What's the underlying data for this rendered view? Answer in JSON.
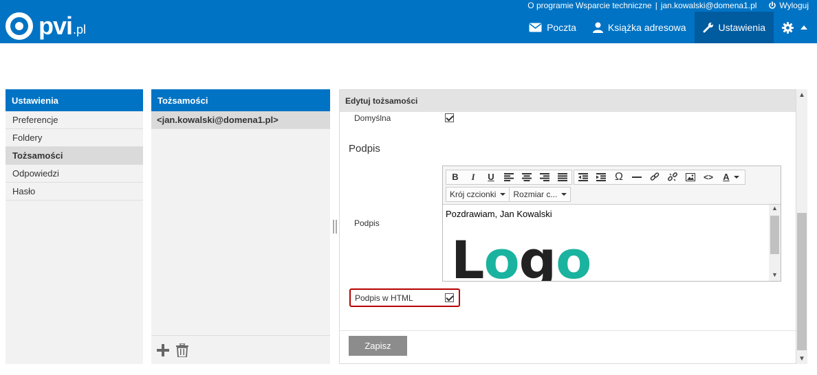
{
  "header": {
    "logo_text": "pvi",
    "logo_tld": ".pl",
    "toplinks": {
      "about": "O programie",
      "support": "Wsparcie techniczne",
      "separator": "|",
      "user": "jan.kowalski@domena1.pl",
      "logout": "Wyloguj"
    },
    "nav": {
      "mail": "Poczta",
      "contacts": "Książka adresowa",
      "settings": "Ustawienia"
    }
  },
  "settings_column": {
    "title": "Ustawienia",
    "items": [
      "Preferencje",
      "Foldery",
      "Tożsamości",
      "Odpowiedzi",
      "Hasło"
    ],
    "selected": "Tożsamości"
  },
  "identities_column": {
    "title": "Tożsamości",
    "items": [
      "<jan.kowalski@domena1.pl>"
    ]
  },
  "form": {
    "title": "Edytuj tożsamości",
    "default_label": "Domyślna",
    "default_checked": true,
    "section_title": "Podpis",
    "signature_label": "Podpis",
    "font_select": "Krój czcionki",
    "size_select": "Rozmiar c...",
    "signature_text": "Pozdrawiam, Jan Kowalski",
    "logo_letters": {
      "l": "L",
      "o1": "o",
      "g": "g",
      "o2": "o"
    },
    "html_label": "Podpis w HTML",
    "html_checked": true,
    "save": "Zapisz"
  },
  "colors": {
    "brand": "#0073c4",
    "nav_active": "#005b9f",
    "logo_teal": "#1ab39f",
    "highlight_border": "#b50000"
  }
}
